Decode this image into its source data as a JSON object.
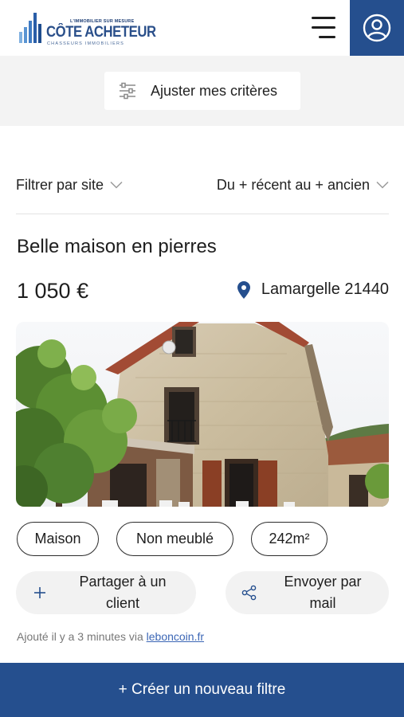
{
  "header": {
    "logo": {
      "tagline": "L'IMMOBILIER SUR MESURE",
      "name": "CÔTE ACHETEUR",
      "subtitle": "CHASSEURS IMMOBILIERS"
    },
    "menu_icon": "hamburger-icon",
    "account_icon": "user-circle-icon"
  },
  "criteria": {
    "label": "Ajuster mes critères",
    "icon": "sliders-icon"
  },
  "filters": {
    "site_label": "Filtrer par site",
    "sort_label": "Du + récent au + ancien"
  },
  "listing": {
    "title": "Belle maison en pierres",
    "price": "1 050 €",
    "location": "Lamargelle 21440",
    "tags": [
      "Maison",
      "Non meublé",
      "242m²"
    ],
    "share_label_line1": "Partager à un",
    "share_label_line2": "client",
    "mail_label_line1": "Envoyer par",
    "mail_label_line2": "mail",
    "added_prefix": "Ajouté il y a 3 minutes via",
    "source": "leboncoin.fr"
  },
  "bottom": {
    "create_filter_label": "+ Créer un nouveau filtre"
  },
  "colors": {
    "brand": "#254f8e",
    "link": "#3b66b5"
  }
}
